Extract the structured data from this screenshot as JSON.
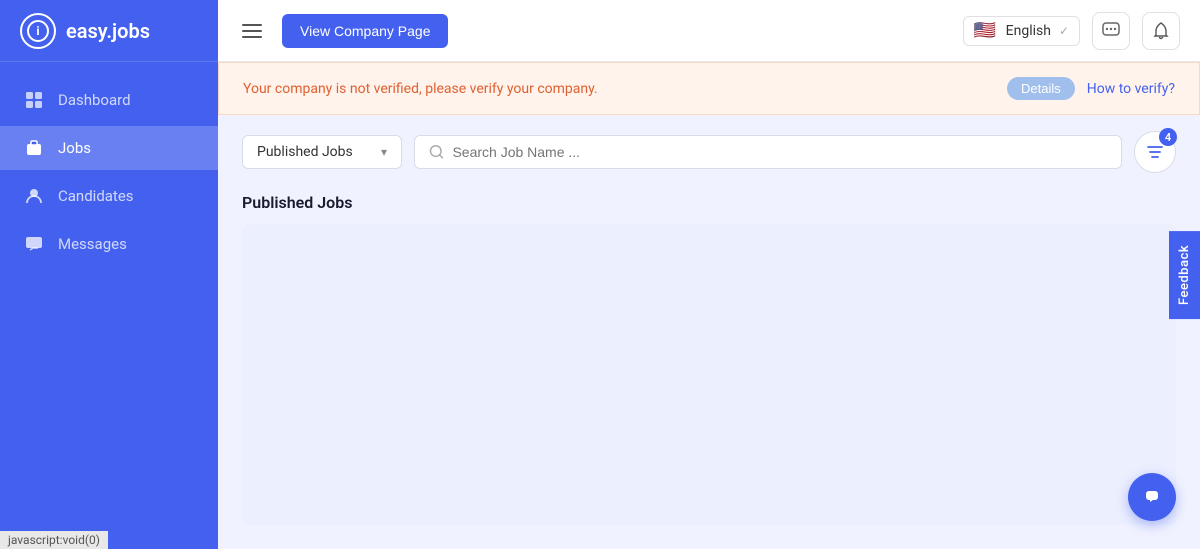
{
  "sidebar": {
    "logo": {
      "icon_text": "i",
      "app_name": "easy.jobs"
    },
    "nav_items": [
      {
        "id": "dashboard",
        "label": "Dashboard",
        "icon": "⊞",
        "active": false
      },
      {
        "id": "jobs",
        "label": "Jobs",
        "icon": "💼",
        "active": true
      },
      {
        "id": "candidates",
        "label": "Candidates",
        "icon": "👤",
        "active": false
      },
      {
        "id": "messages",
        "label": "Messages",
        "icon": "💬",
        "active": false
      }
    ]
  },
  "header": {
    "view_company_label": "View Company Page",
    "language": {
      "flag": "🇺🇸",
      "label": "English"
    },
    "icons": {
      "chat": "💬",
      "bell": "🔔"
    }
  },
  "alert": {
    "message": "Your company is not verified, please verify your company.",
    "details_label": "Details",
    "how_to_verify_label": "How to verify?"
  },
  "toolbar": {
    "filter_label": "Published Jobs",
    "search_placeholder": "Search Job Name ...",
    "filter_count": "4"
  },
  "jobs_section": {
    "title": "Published Jobs"
  },
  "feedback": {
    "label": "Feedback"
  },
  "status_bar": {
    "text": "javascript:void(0)"
  }
}
